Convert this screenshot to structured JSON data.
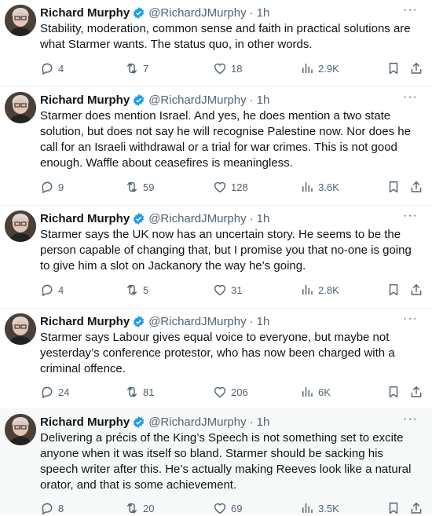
{
  "tweets": [
    {
      "name": "Richard Murphy",
      "handle": "@RichardJMurphy",
      "time": "1h",
      "dot": "·",
      "text": "Stability, moderation, common sense and faith in practical solutions are what Starmer wants. The status quo, in other words.",
      "replies": "4",
      "retweets": "7",
      "likes": "18",
      "views": "2.9K"
    },
    {
      "name": "Richard Murphy",
      "handle": "@RichardJMurphy",
      "time": "1h",
      "dot": "·",
      "text": "Starmer does mention Israel. And yes, he does mention a two state solution, but does not say he will recognise Palestine now. Nor does he call for an Israeli withdrawal or a trial for war crimes. This is not good enough. Waffle about ceasefires is meaningless.",
      "replies": "9",
      "retweets": "59",
      "likes": "128",
      "views": "3.6K"
    },
    {
      "name": "Richard Murphy",
      "handle": "@RichardJMurphy",
      "time": "1h",
      "dot": "·",
      "text": "Starmer says the UK now has an uncertain story. He seems to be the person capable of changing that, but I promise you that no-one is going to give him a slot on Jackanory the way he’s going.",
      "replies": "4",
      "retweets": "5",
      "likes": "31",
      "views": "2.8K"
    },
    {
      "name": "Richard Murphy",
      "handle": "@RichardJMurphy",
      "time": "1h",
      "dot": "·",
      "text": "Starmer says Labour gives equal voice to everyone, but maybe not yesterday’s conference protestor, who has now been charged with a criminal offence.",
      "replies": "24",
      "retweets": "81",
      "likes": "206",
      "views": "6K"
    },
    {
      "name": "Richard Murphy",
      "handle": "@RichardJMurphy",
      "time": "1h",
      "dot": "·",
      "text": "Delivering a précis of the King’s Speech is not something set to excite anyone when it was itself so bland. Starmer should be sacking his speech writer after this. He’s actually making Reeves look like a natural orator, and that is some achievement.",
      "replies": "8",
      "retweets": "20",
      "likes": "69",
      "views": "3.5K"
    }
  ],
  "more_label": "···",
  "colors": {
    "verified": "#1d9bf0",
    "muted": "#536471",
    "text": "#0f1419",
    "highlight_bg": "#f7f9f9"
  }
}
